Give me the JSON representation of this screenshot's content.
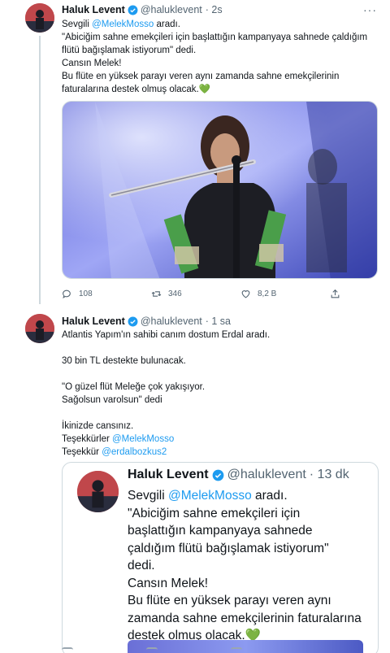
{
  "tweet1": {
    "name": "Haluk Levent",
    "handle": "@haluklevent",
    "time": "· 2s",
    "more": "···",
    "lines": {
      "l1_pre": "Sevgili ",
      "l1_mention": "@MelekMosso",
      "l1_post": " aradı.",
      "l2": "\"Abiciğim sahne emekçileri için başlattığın kampanyaya sahnede çaldığım",
      "l3": "flütü bağışlamak istiyorum\" dedi.",
      "l4": "Cansın Melek!",
      "l5": "Bu flüte en yüksek parayı veren aynı zamanda sahne emekçilerinin",
      "l6": "faturalarına destek olmuş olacak.💚"
    },
    "actions": {
      "reply_count": "108",
      "retweet_count": "346",
      "like_count": "8,2 B"
    }
  },
  "tweet2": {
    "name": "Haluk Levent",
    "handle": "@haluklevent",
    "time": "· 1 sa",
    "lines": {
      "l1": "Atlantis Yapım'ın sahibi canım dostum Erdal aradı.",
      "l2": "30 bin TL destekte bulunacak.",
      "l3": "\"O güzel flüt Meleğe çok yakışıyor.",
      "l4": "Sağolsun varolsun\" dedi",
      "l5": "İkinizde cansınız.",
      "l6_pre": "Teşekkürler ",
      "l6_mention": "@MelekMosso",
      "l7_pre": "Teşekkür ",
      "l7_mention": "@erdalbozkus2"
    }
  },
  "quote": {
    "name": "Haluk Levent",
    "handle": "@haluklevent",
    "time": "· 13 dk",
    "lines": {
      "l1_pre": "Sevgili ",
      "l1_mention": "@MelekMosso",
      "l1_post": " aradı.",
      "l2": "\"Abiciğim sahne emekçileri için",
      "l3": "başlattığın kampanyaya sahnede",
      "l4": "çaldığım flütü bağışlamak istiyorum\"",
      "l5": "dedi.",
      "l6": "Cansın Melek!",
      "l7": "Bu flüte en yüksek parayı veren aynı",
      "l8": "zamanda sahne emekçilerinin faturalarına",
      "l9": "destek olmuş olacak.💚"
    }
  },
  "colors": {
    "accent": "#1d9bf0",
    "verified": "#1d9bf0",
    "muted": "#536471"
  },
  "icons": [
    "more-icon",
    "verified-icon",
    "reply-icon",
    "retweet-icon",
    "like-icon",
    "share-icon"
  ]
}
